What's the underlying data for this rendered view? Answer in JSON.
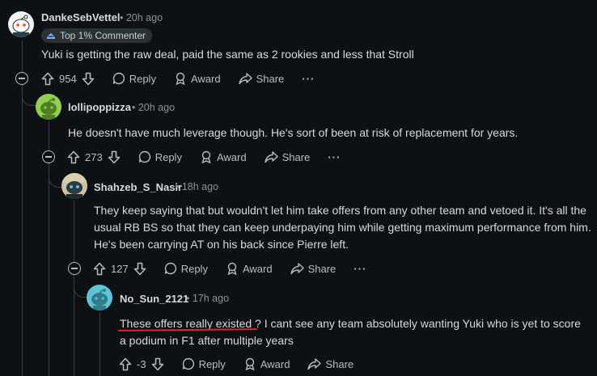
{
  "labels": {
    "reply": "Reply",
    "award": "Award",
    "share": "Share",
    "more": "···"
  },
  "comments": [
    {
      "author": "DankeSebVettel",
      "time": "• 20h ago",
      "badge": "Top 1% Commenter",
      "text": "Yuki is getting the raw deal, paid the same as 2 rookies and less that Stroll",
      "votes": "954"
    },
    {
      "author": "lollipoppizza",
      "time": "• 20h ago",
      "text": "He doesn't have much leverage though. He's sort of been at risk of replacement for years.",
      "votes": "273"
    },
    {
      "author": "Shahzeb_S_Nasir",
      "time": "• 18h ago",
      "text": "They keep saying that but wouldn't let him take offers from any other team and vetoed it. It's all the usual RB BS so that they can keep underpaying him while getting maximum performance from him. He's been carrying AT on his back since Pierre left.",
      "votes": "127"
    },
    {
      "author": "No_Sun_2121",
      "time": "• 17h ago",
      "text_highlight": "These offers really existed ?",
      "text_rest": " I cant see any team absolutely wanting Yuki who is yet to score a podium in F1 after multiple years",
      "votes": "-3"
    }
  ],
  "colors": {
    "background": "#0e1113",
    "underline": "#e0242e",
    "avatar2": "#8fd14f",
    "avatar4": "#5ec4d6"
  }
}
